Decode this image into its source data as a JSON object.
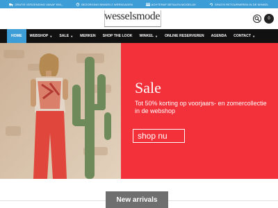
{
  "promo": [
    {
      "icon": "truck-icon",
      "text": "Gratis verzending vanaf €50,-"
    },
    {
      "icon": "clock-icon",
      "text": "Bezorging binnen 2 werkdagen"
    },
    {
      "icon": "card-icon",
      "text": "Achteraf betalen mogelijk"
    },
    {
      "icon": "return-icon",
      "text": "Gratis retourneren in de winkel"
    }
  ],
  "logo": {
    "part1": "wessels",
    "part2": "mode"
  },
  "cart": {
    "count": "0"
  },
  "nav": [
    {
      "label": "Home",
      "dropdown": false,
      "active": true
    },
    {
      "label": "Webshop",
      "dropdown": true,
      "active": false
    },
    {
      "label": "Sale",
      "dropdown": true,
      "active": false
    },
    {
      "label": "Merken",
      "dropdown": false,
      "active": false
    },
    {
      "label": "Shop the look",
      "dropdown": false,
      "active": false
    },
    {
      "label": "Winkel",
      "dropdown": true,
      "active": false
    },
    {
      "label": "Online reserveren",
      "dropdown": false,
      "active": false
    },
    {
      "label": "Agenda",
      "dropdown": false,
      "active": false
    },
    {
      "label": "Contact",
      "dropdown": true,
      "active": false
    }
  ],
  "hero": {
    "title": "Sale",
    "text": "Tot 50% korting op voorjaars- en zomercollectie in de webshop",
    "button": "shop nu",
    "bg_color": "#f2313a"
  },
  "section": {
    "title": "New arrivals"
  },
  "colors": {
    "accent": "#3d9dd6",
    "nav_bg": "#111111",
    "sale_red": "#f2313a"
  }
}
